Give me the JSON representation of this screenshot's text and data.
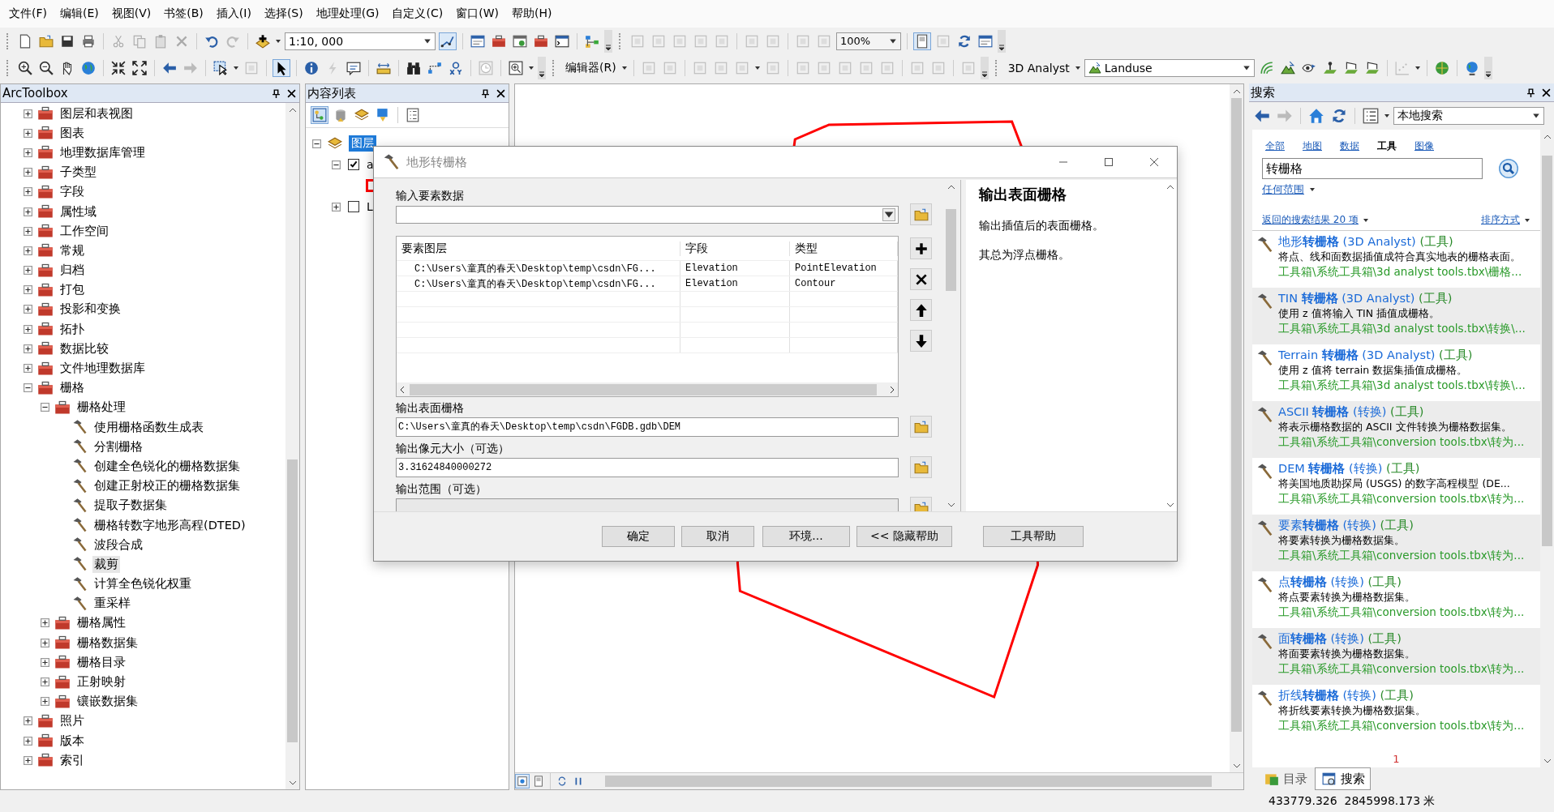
{
  "menu_bar": [
    "文件(F)",
    "编辑(E)",
    "视图(V)",
    "书签(B)",
    "插入(I)",
    "选择(S)",
    "地理处理(G)",
    "自定义(C)",
    "窗口(W)",
    "帮助(H)"
  ],
  "standard_toolbar": {
    "scale": "1:10, 000",
    "zoom": "100%"
  },
  "editor_toolbar": {
    "label": "编辑器(R)"
  },
  "analyst_toolbar": {
    "label": "3D Analyst",
    "layer": "Landuse"
  },
  "arctoolbox": {
    "title": "ArcToolbox",
    "items": [
      {
        "label": "图层和表视图",
        "kind": "toolbox",
        "expanded": false
      },
      {
        "label": "图表",
        "kind": "toolbox",
        "expanded": false
      },
      {
        "label": "地理数据库管理",
        "kind": "toolbox",
        "expanded": false
      },
      {
        "label": "子类型",
        "kind": "toolbox",
        "expanded": false
      },
      {
        "label": "字段",
        "kind": "toolbox",
        "expanded": false
      },
      {
        "label": "属性域",
        "kind": "toolbox",
        "expanded": false
      },
      {
        "label": "工作空间",
        "kind": "toolbox",
        "expanded": false
      },
      {
        "label": "常规",
        "kind": "toolbox",
        "expanded": false
      },
      {
        "label": "归档",
        "kind": "toolbox",
        "expanded": false
      },
      {
        "label": "打包",
        "kind": "toolbox",
        "expanded": false
      },
      {
        "label": "投影和变换",
        "kind": "toolbox",
        "expanded": false
      },
      {
        "label": "拓扑",
        "kind": "toolbox",
        "expanded": false
      },
      {
        "label": "数据比较",
        "kind": "toolbox",
        "expanded": false
      },
      {
        "label": "文件地理数据库",
        "kind": "toolbox",
        "expanded": false
      },
      {
        "label": "栅格",
        "kind": "toolbox",
        "expanded": true,
        "children": [
          {
            "label": "栅格处理",
            "kind": "toolbox",
            "expanded": true,
            "children": [
              {
                "label": "使用栅格函数生成表",
                "kind": "tool",
                "selected": false
              },
              {
                "label": "分割栅格",
                "kind": "tool",
                "selected": false
              },
              {
                "label": "创建全色锐化的栅格数据集",
                "kind": "tool",
                "selected": false
              },
              {
                "label": "创建正射校正的栅格数据集",
                "kind": "tool",
                "selected": false
              },
              {
                "label": "提取子数据集",
                "kind": "tool",
                "selected": false
              },
              {
                "label": "栅格转数字地形高程(DTED)",
                "kind": "tool",
                "selected": false
              },
              {
                "label": "波段合成",
                "kind": "tool",
                "selected": false
              },
              {
                "label": "裁剪",
                "kind": "tool",
                "selected": true
              },
              {
                "label": "计算全色锐化权重",
                "kind": "tool",
                "selected": false
              },
              {
                "label": "重采样",
                "kind": "tool",
                "selected": false
              }
            ]
          },
          {
            "label": "栅格属性",
            "kind": "toolbox",
            "expanded": false
          },
          {
            "label": "栅格数据集",
            "kind": "toolbox",
            "expanded": false
          },
          {
            "label": "栅格目录",
            "kind": "toolbox",
            "expanded": false
          },
          {
            "label": "正射映射",
            "kind": "toolbox",
            "expanded": false
          },
          {
            "label": "镶嵌数据集",
            "kind": "toolbox",
            "expanded": false
          }
        ]
      },
      {
        "label": "照片",
        "kind": "toolbox",
        "expanded": false
      },
      {
        "label": "版本",
        "kind": "toolbox",
        "expanded": false
      },
      {
        "label": "索引",
        "kind": "toolbox",
        "expanded": false
      }
    ]
  },
  "table_of_contents": {
    "title": "内容列表",
    "root": {
      "label": "图层",
      "selected": true,
      "expanded": true
    },
    "layers": [
      {
        "label": "a",
        "checked": true,
        "expanded": true
      },
      {
        "label": "L",
        "checked": false,
        "expanded": false
      }
    ]
  },
  "dialog": {
    "title": "地形转栅格",
    "input_label": "输入要素数据",
    "table": {
      "columns": [
        "要素图层",
        "字段",
        "类型"
      ],
      "rows": [
        [
          "C:\\Users\\童真的春天\\Desktop\\temp\\csdn\\FG...",
          "Elevation",
          "PointElevation"
        ],
        [
          "C:\\Users\\童真的春天\\Desktop\\temp\\csdn\\FG...",
          "Elevation",
          "Contour"
        ]
      ]
    },
    "fields": [
      {
        "label": "输出表面栅格",
        "value": "C:\\Users\\童真的春天\\Desktop\\temp\\csdn\\FGDB.gdb\\DEM"
      },
      {
        "label": "输出像元大小（可选）",
        "value": "3.31624840000272"
      },
      {
        "label": "输出范围（可选）"
      }
    ],
    "help": {
      "title": "输出表面栅格",
      "paragraphs": [
        "输出插值后的表面栅格。",
        "其总为浮点栅格。"
      ]
    },
    "buttons": [
      "确定",
      "取消",
      "环境...",
      "<< 隐藏帮助",
      "工具帮助"
    ]
  },
  "search": {
    "title": "搜索",
    "scope": "本地搜索",
    "tabs": [
      {
        "label": "全部",
        "selected": false
      },
      {
        "label": "地图",
        "selected": false
      },
      {
        "label": "数据",
        "selected": false
      },
      {
        "label": "工具",
        "selected": true
      },
      {
        "label": "图像",
        "selected": false
      }
    ],
    "query": "转栅格",
    "extent": "任何范围",
    "result_count": "返回的搜索结果 20 项",
    "sort": "排序方式",
    "results": [
      {
        "name": "地形**转栅格**",
        "category": "(3D Analyst)",
        "type": "(工具)",
        "description": "将点、线和面数据插值成符合真实地表的栅格表面。",
        "path": "工具箱\\系统工具箱\\3d analyst tools.tbx\\栅格..."
      },
      {
        "name": "TIN **转栅格**",
        "category": "(3D Analyst)",
        "type": "(工具)",
        "description": "使用 z 值将输入 TIN 插值成栅格。",
        "path": "工具箱\\系统工具箱\\3d analyst tools.tbx\\转换\\..."
      },
      {
        "name": "Terrain **转栅格**",
        "category": "(3D Analyst)",
        "type": "(工具)",
        "description": "使用 z 值将 terrain 数据集插值成栅格。",
        "path": "工具箱\\系统工具箱\\3d analyst tools.tbx\\转换\\..."
      },
      {
        "name": "ASCII **转栅格**",
        "category": "(转换)",
        "type": "(工具)",
        "description": "将表示栅格数据的 ASCII 文件转换为栅格数据集。",
        "path": "工具箱\\系统工具箱\\conversion tools.tbx\\转为..."
      },
      {
        "name": "DEM **转栅格**",
        "category": "(转换)",
        "type": "(工具)",
        "description": "将美国地质勘探局 (USGS) 的数字高程模型 (DE...",
        "path": "工具箱\\系统工具箱\\conversion tools.tbx\\转为..."
      },
      {
        "name": "要素**转栅格**",
        "category": "(转换)",
        "type": "(工具)",
        "description": "将要素转换为栅格数据集。",
        "path": "工具箱\\系统工具箱\\conversion tools.tbx\\转为..."
      },
      {
        "name": "点**转栅格**",
        "category": "(转换)",
        "type": "(工具)",
        "description": "将点要素转换为栅格数据集。",
        "path": "工具箱\\系统工具箱\\conversion tools.tbx\\转为..."
      },
      {
        "name": "面**转栅格**",
        "category": "(转换)",
        "type": "(工具)",
        "description": "将面要素转换为栅格数据集。",
        "path": "工具箱\\系统工具箱\\conversion tools.tbx\\转为..."
      },
      {
        "name": "折线**转栅格**",
        "category": "(转换)",
        "type": "(工具)",
        "description": "将折线要素转换为栅格数据集。",
        "path": "工具箱\\系统工具箱\\conversion tools.tbx\\转为..."
      }
    ],
    "page": "1",
    "bottom_tabs": [
      {
        "label": "目录",
        "selected": false
      },
      {
        "label": "搜索",
        "selected": true
      }
    ]
  },
  "status_bar": {
    "coordinates": "433779.326  2845998.173 米"
  }
}
